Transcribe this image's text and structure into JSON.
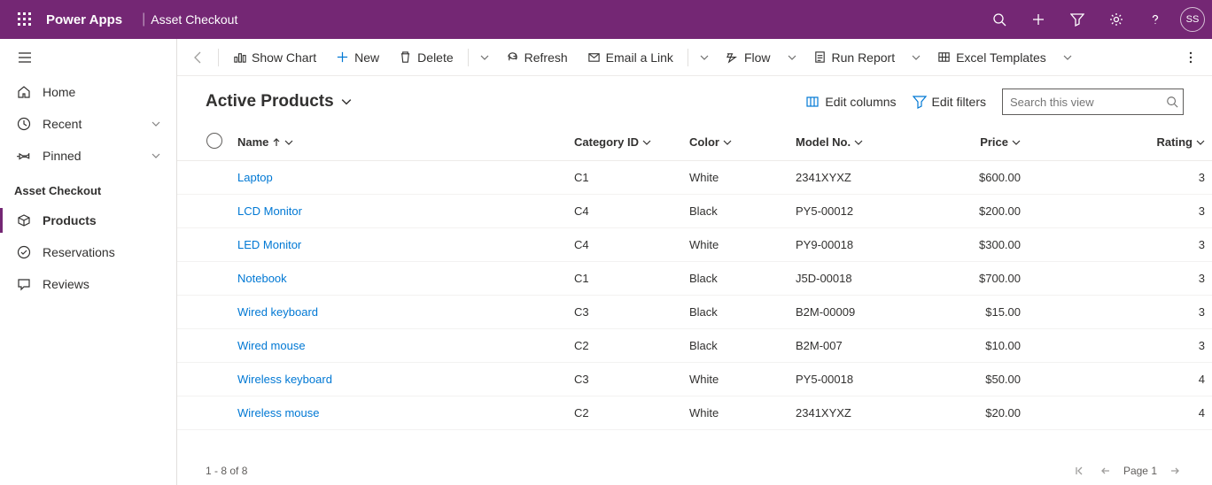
{
  "header": {
    "brand": "Power Apps",
    "app_name": "Asset Checkout",
    "user_initials": "SS"
  },
  "sidebar": {
    "items": [
      {
        "label": "Home",
        "icon": "home"
      },
      {
        "label": "Recent",
        "icon": "recent",
        "expandable": true
      },
      {
        "label": "Pinned",
        "icon": "pin",
        "expandable": true
      }
    ],
    "section_title": "Asset Checkout",
    "section_items": [
      {
        "label": "Products",
        "icon": "cube",
        "active": true
      },
      {
        "label": "Reservations",
        "icon": "check-circle"
      },
      {
        "label": "Reviews",
        "icon": "comment"
      }
    ]
  },
  "commandbar": {
    "show_chart": "Show Chart",
    "new": "New",
    "delete": "Delete",
    "refresh": "Refresh",
    "email_link": "Email a Link",
    "flow": "Flow",
    "run_report": "Run Report",
    "excel_templates": "Excel Templates"
  },
  "view": {
    "title": "Active Products",
    "edit_columns": "Edit columns",
    "edit_filters": "Edit filters",
    "search_placeholder": "Search this view"
  },
  "columns": {
    "name": "Name",
    "category_id": "Category ID",
    "color": "Color",
    "model_no": "Model No.",
    "price": "Price",
    "rating": "Rating"
  },
  "rows": [
    {
      "name": "Laptop",
      "category_id": "C1",
      "color": "White",
      "model_no": "2341XYXZ",
      "price": "$600.00",
      "rating": "3"
    },
    {
      "name": "LCD Monitor",
      "category_id": "C4",
      "color": "Black",
      "model_no": "PY5-00012",
      "price": "$200.00",
      "rating": "3"
    },
    {
      "name": "LED Monitor",
      "category_id": "C4",
      "color": "White",
      "model_no": "PY9-00018",
      "price": "$300.00",
      "rating": "3"
    },
    {
      "name": "Notebook",
      "category_id": "C1",
      "color": "Black",
      "model_no": "J5D-00018",
      "price": "$700.00",
      "rating": "3"
    },
    {
      "name": "Wired keyboard",
      "category_id": "C3",
      "color": "Black",
      "model_no": "B2M-00009",
      "price": "$15.00",
      "rating": "3"
    },
    {
      "name": "Wired mouse",
      "category_id": "C2",
      "color": "Black",
      "model_no": "B2M-007",
      "price": "$10.00",
      "rating": "3"
    },
    {
      "name": "Wireless keyboard",
      "category_id": "C3",
      "color": "White",
      "model_no": "PY5-00018",
      "price": "$50.00",
      "rating": "4"
    },
    {
      "name": "Wireless mouse",
      "category_id": "C2",
      "color": "White",
      "model_no": "2341XYXZ",
      "price": "$20.00",
      "rating": "4"
    }
  ],
  "footer": {
    "range": "1 - 8 of 8",
    "page_label": "Page 1"
  }
}
